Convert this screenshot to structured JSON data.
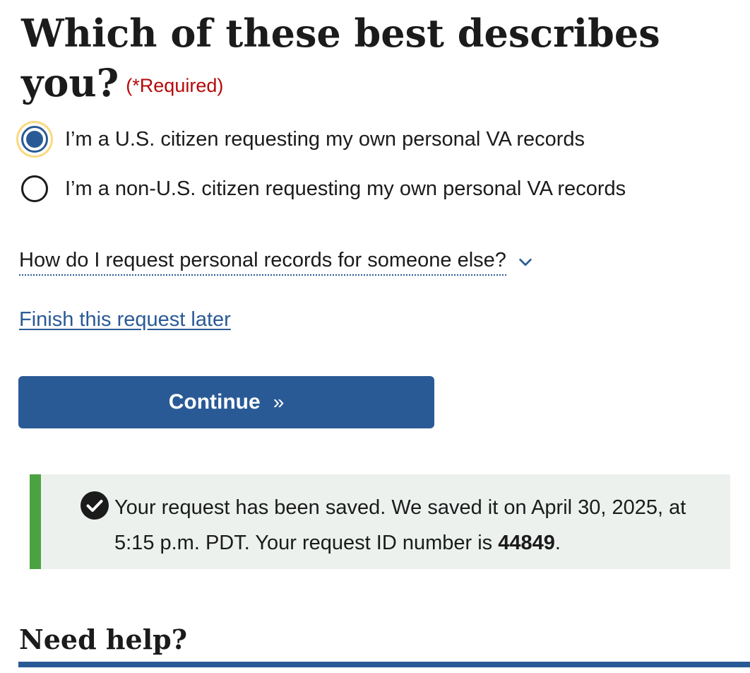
{
  "form": {
    "question": "Which of these best describes you?",
    "required_label": "(*Required)",
    "options": [
      {
        "label": "I’m a U.S. citizen requesting my own personal VA records",
        "selected": true
      },
      {
        "label": "I’m a non-U.S. citizen requesting my own personal VA records",
        "selected": false
      }
    ],
    "accordion_label": "How do I request personal records for someone else?",
    "finish_later_link": "Finish this request later",
    "continue_label": "Continue",
    "continue_arrows": "»"
  },
  "alert": {
    "type": "success",
    "icon": "check-circle-icon",
    "text_before": "Your request has been saved. We saved it on April 30, 2025, at 5:15 p.m. PDT. Your request ID number is ",
    "request_id": "44849",
    "text_after": "."
  },
  "help": {
    "heading": "Need help?"
  },
  "colors": {
    "primary": "#2a5a96",
    "required": "#b50909",
    "success_border": "#4aa340",
    "success_bg": "#ecf1ee",
    "focus_ring": "#fad980"
  }
}
